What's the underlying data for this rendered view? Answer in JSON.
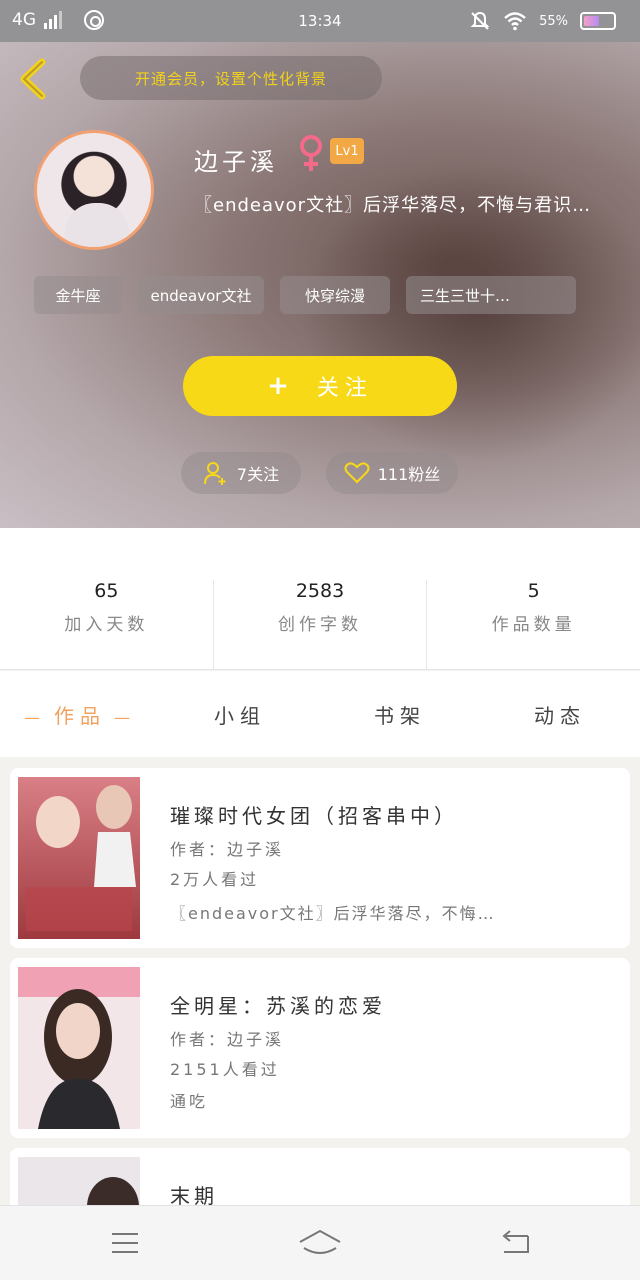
{
  "status_bar": {
    "network": "4G",
    "time": "13:34",
    "battery_percent": "55%"
  },
  "header": {
    "vip_banner": "开通会员，设置个性化背景",
    "username": "边子溪",
    "level": "Lv1",
    "bio": "〖endeavor文社〗后浮华落尽，不悔与君识…",
    "tags": [
      "金牛座",
      "endeavor文社",
      "快穿综漫",
      "三生三世十…"
    ],
    "follow_button": "关注",
    "following": "7关注",
    "fans": "111粉丝"
  },
  "stats": [
    {
      "value": "65",
      "label": "加入天数"
    },
    {
      "value": "2583",
      "label": "创作字数"
    },
    {
      "value": "5",
      "label": "作品数量"
    }
  ],
  "tabs": [
    "作品",
    "小组",
    "书架",
    "动态"
  ],
  "works": [
    {
      "title": "璀璨时代女团（招客串中）",
      "author": "作者：边子溪",
      "reads": "2万人看过",
      "summary": "〖endeavor文社〗后浮华落尽，不悔…"
    },
    {
      "title": "全明星：苏溪的恋爱",
      "author": "作者：边子溪",
      "reads": "2151人看过",
      "status": "通吃"
    },
    {
      "title": "末期"
    }
  ],
  "colors": {
    "accent_yellow": "#f7d917",
    "tab_active": "#f3a15f",
    "level_badge": "#f3a846"
  }
}
